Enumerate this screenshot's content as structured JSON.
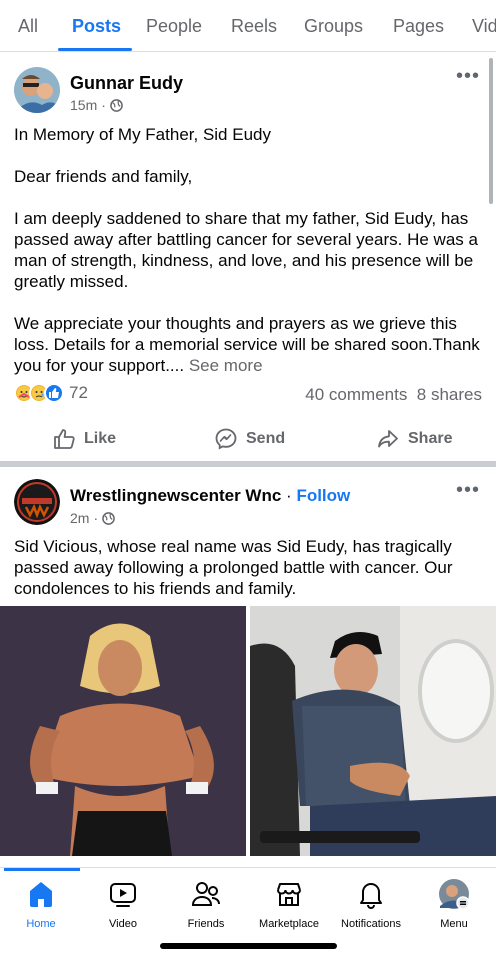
{
  "tabs": [
    "All",
    "Posts",
    "People",
    "Reels",
    "Groups",
    "Pages",
    "Vid"
  ],
  "active_tab": "Posts",
  "post1": {
    "author": "Gunnar Eudy",
    "time": "15m",
    "paragraphs": [
      "In Memory of My Father, Sid Eudy",
      "Dear friends and family,",
      "I am deeply saddened to share that my father, Sid Eudy, has passed away after battling cancer for several years. He was a man of strength, kindness, and love, and his presence will be greatly missed."
    ],
    "last_paragraph": "We appreciate your thoughts and prayers as we grieve this loss. Details for a memorial service will be shared soon.Thank you for your support....",
    "see_more": "See more",
    "reaction_count": "72",
    "comments": "40 comments",
    "shares": "8 shares",
    "reaction_icons": [
      "care-emoji",
      "sad-emoji",
      "like-icon"
    ]
  },
  "actions": {
    "like": "Like",
    "send": "Send",
    "share": "Share"
  },
  "post2": {
    "author": "Wrestlingnewscenter Wnc",
    "separator": "·",
    "follow": "Follow",
    "time": "2m",
    "text": "Sid Vicious, whose real name was Sid Eudy, has tragically passed away following a prolonged battle with cancer. Our condolences to his friends and family."
  },
  "bottom_nav": [
    {
      "label": "Home",
      "icon": "home-icon",
      "active": true
    },
    {
      "label": "Video",
      "icon": "video-icon",
      "active": false
    },
    {
      "label": "Friends",
      "icon": "friends-icon",
      "active": false
    },
    {
      "label": "Marketplace",
      "icon": "marketplace-icon",
      "active": false
    },
    {
      "label": "Notifications",
      "icon": "bell-icon",
      "active": false
    },
    {
      "label": "Menu",
      "icon": "profile-menu-icon",
      "active": false
    }
  ],
  "colors": {
    "accent": "#1877f2",
    "secondary_text": "#65676b"
  }
}
